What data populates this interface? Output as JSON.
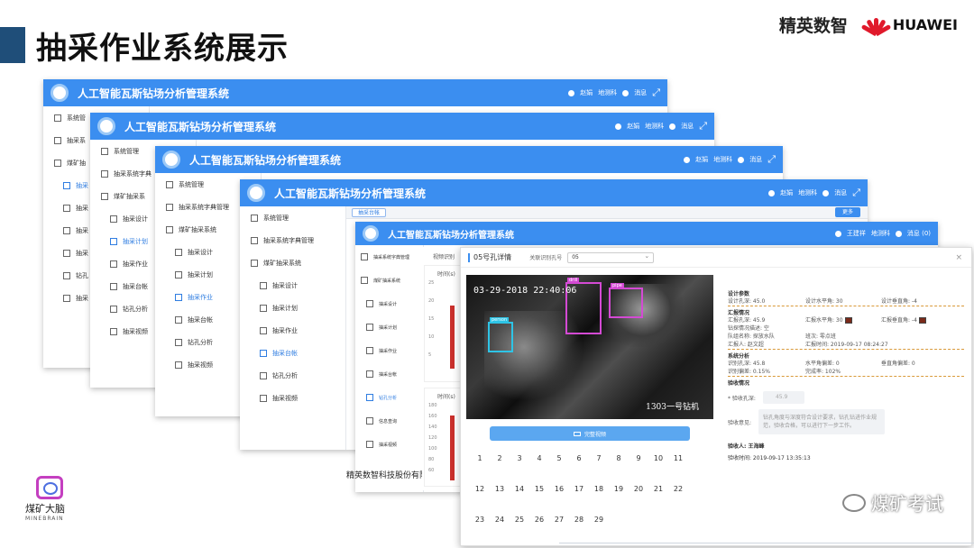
{
  "slide": {
    "title": "抽采作业系统展示",
    "brand_logo": "精英数智",
    "partner_logo": "HUAWEI",
    "footer_brand_cn": "煤矿大脑",
    "footer_brand_en": "MINEBRAIN",
    "watermark": "煤矿考试",
    "accent_color": "#1f4e79"
  },
  "app": {
    "title": "人工智能瓦斯钻场分析管理系统",
    "user_name": "赵娟",
    "user_role": "地测科",
    "messages": "消息",
    "front_user": "王建祥",
    "front_role": "地测科",
    "front_messages": "消息 (0)",
    "header_color": "#3b8ef0",
    "company": "精英数智科技股份有限公",
    "tab_label": "抽采台帐",
    "more_button": "更多"
  },
  "menu": {
    "system_mgmt": "系统管理",
    "dict_mgmt": "抽采系统字典管理",
    "coal_system": "煤矿抽采系统",
    "design": "抽采设计",
    "plan": "抽采计划",
    "operation": "抽采作业",
    "ledger": "抽采台帐",
    "drill_analysis": "钻孔分析",
    "video": "抽采视频",
    "system_mgmt_short": "系统管",
    "dict_short": "抽采系",
    "coal_short": "煤矿抽",
    "design_short": "抽采",
    "plan_short": "抽采",
    "op_short": "抽采",
    "ledger_short": "抽采",
    "drill_short": "钻孔",
    "video_short": "抽采",
    "dict_mid": "抽采系统字典",
    "coal_mid": "煤矿抽采系",
    "front_dict": "抽采系统字典管理",
    "front_coal": "煤矿抽采系统",
    "front_design": "抽采设计",
    "front_plan": "抽采计划",
    "front_op": "抽采作业",
    "front_ledger": "抽采台帐",
    "front_drill": "钻孔分析",
    "front_info": "信息查询",
    "front_video": "抽采视频"
  },
  "dashboard": {
    "label_top": "视频识别",
    "unit1": "时间(s)",
    "ticks1": [
      "25",
      "20",
      "15",
      "10",
      "5"
    ],
    "unit2": "时间(s)",
    "ticks2": [
      "180",
      "160",
      "140",
      "120",
      "100",
      "80",
      "60"
    ]
  },
  "modal": {
    "title": "05号孔详情",
    "assoc_label": "关联识别孔号",
    "assoc_value": "05",
    "close": "×",
    "video_timestamp": "03-29-2018  22:40:06",
    "video_caption": "1303一号钻机",
    "detect_label_1": "person",
    "detect_label_2": "drill",
    "detect_label_3": "pipe",
    "play_button": "完整视频",
    "days": [
      "1",
      "2",
      "3",
      "4",
      "5",
      "6",
      "7",
      "8",
      "9",
      "10",
      "11",
      "12",
      "13",
      "14",
      "15",
      "16",
      "17",
      "18",
      "19",
      "20",
      "21",
      "22",
      "23",
      "24",
      "25",
      "26",
      "27",
      "28",
      "29"
    ]
  },
  "details": {
    "design_title": "设计参数",
    "design_depth": "设计孔深:   45.0",
    "design_h": "设计水平角:   30",
    "design_v": "设计垂直角:   -4",
    "report_title": "汇报情况",
    "report_depth": "汇报孔深:   45.9",
    "report_h": "汇报水平角:   30",
    "report_v": "汇报垂直角:   -4",
    "report_desc": "钻探情况描述:   空",
    "team": "队组名称:   探放水队",
    "shift": "班次:   零点班",
    "reporter": "汇报人:   赵文超",
    "report_time": "汇报时间:   2019-09-17 08:24:27",
    "analysis_title": "系统分析",
    "id_depth": "识别孔深:   45.8",
    "h_dev": "水平角偏差:   0",
    "v_dev": "垂直角偏差:   0",
    "depth_dev": "识别偏差:   0.15%",
    "completion": "完成率:   102%",
    "accept_title": "验收情况",
    "accept_depth_label": "* 验收孔深:",
    "accept_depth_value": "45.9",
    "accept_opinion_label": "验收意见:",
    "accept_opinion_value": "钻孔角度与深度符合设计要求，钻孔钻进作业规范，验收合格，可以进行下一步工作。",
    "acceptor": "验收人:   王海峰",
    "accept_time": "验收时间:   2019-09-17 13:35:13"
  }
}
